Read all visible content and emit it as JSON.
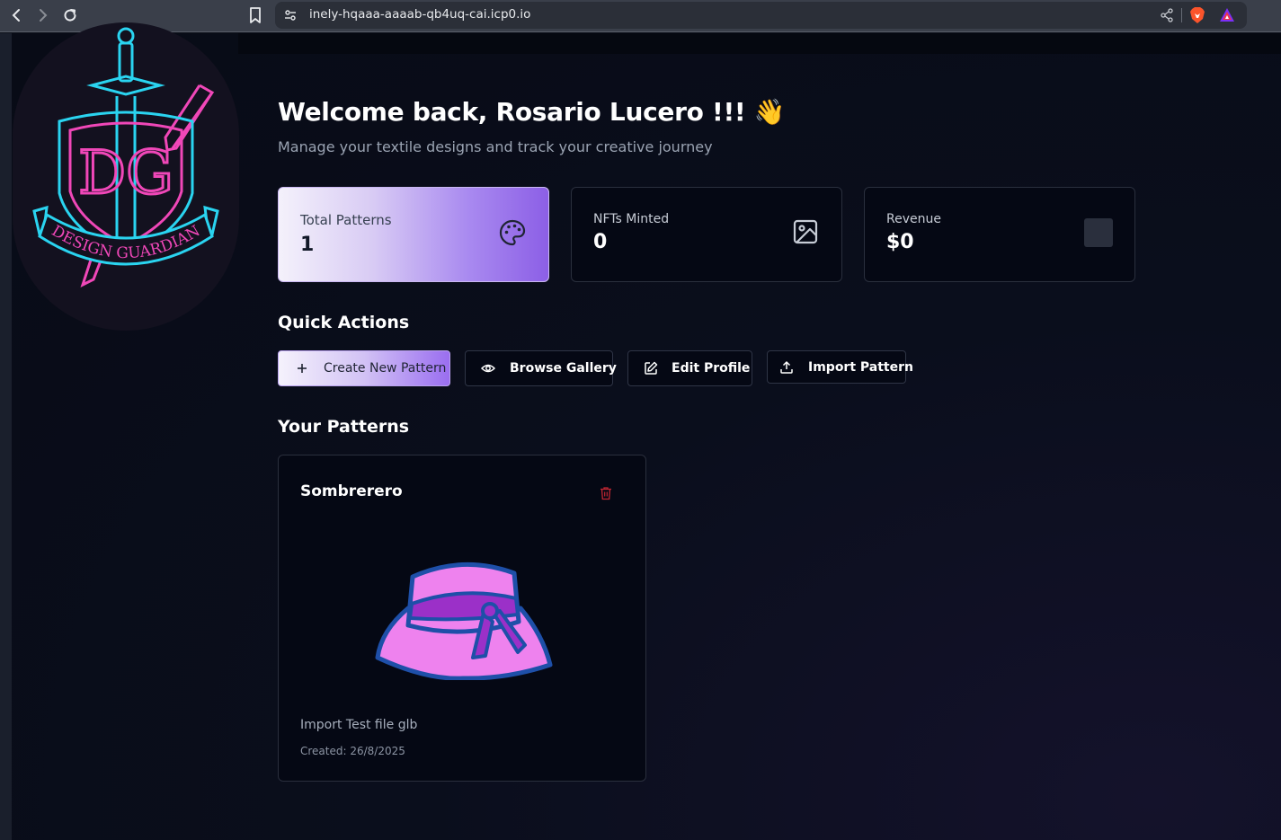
{
  "browser": {
    "url": "inely-hqaaa-aaaab-qb4uq-cai.icp0.io"
  },
  "logo": {
    "initials": "DG",
    "banner_text": "DESIGN GUARDIAN",
    "colors": {
      "cyan": "#2ad4f0",
      "pink": "#f047b8"
    }
  },
  "header": {
    "welcome": "Welcome back, Rosario Lucero !!! 👋",
    "subtitle": "Manage your textile designs and track your creative journey"
  },
  "stats": [
    {
      "label": "Total Patterns",
      "value": "1",
      "icon": "palette-icon"
    },
    {
      "label": "NFTs Minted",
      "value": "0",
      "icon": "image-icon"
    },
    {
      "label": "Revenue",
      "value": "$0",
      "icon": "placeholder-square"
    }
  ],
  "quick_actions": {
    "title": "Quick Actions",
    "buttons": [
      {
        "label": "Create New Pattern",
        "icon": "plus-icon"
      },
      {
        "label": "Browse Gallery",
        "icon": "eye-icon"
      },
      {
        "label": "Edit Profile",
        "icon": "edit-icon"
      },
      {
        "label": "Import Pattern",
        "icon": "upload-icon"
      }
    ]
  },
  "patterns": {
    "title": "Your Patterns",
    "items": [
      {
        "name": "Sombrerero",
        "description": "Import Test file glb",
        "created": "Created: 26/8/2025",
        "colors": {
          "hat": "#ee82ee",
          "ribbon": "#9b30c8",
          "outline": "#1e4fa8"
        }
      }
    ]
  },
  "colors": {
    "accent_purple": "#8c5fe6",
    "danger_red": "#c02632",
    "background": "#0a0e1c"
  }
}
